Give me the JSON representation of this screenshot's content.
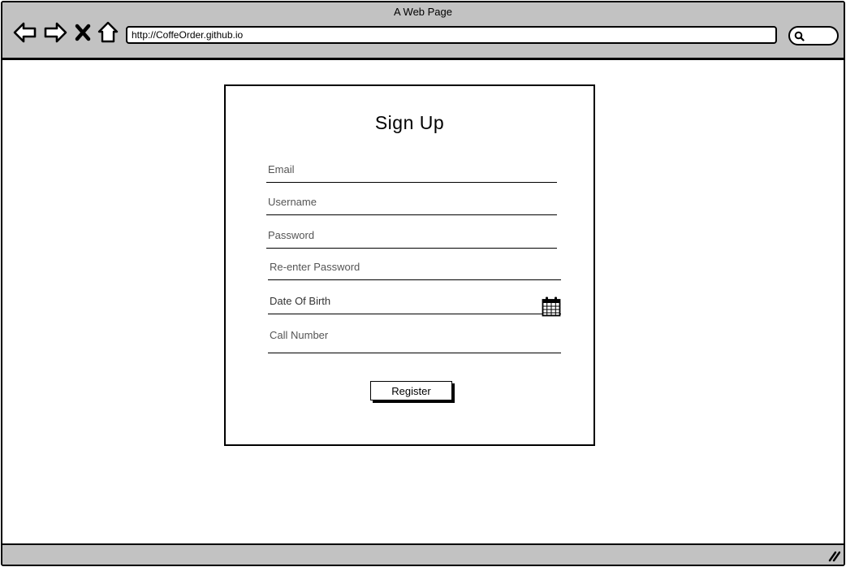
{
  "window": {
    "title": "A Web Page"
  },
  "browser": {
    "url": "http://CoffeOrder.github.io",
    "icons": [
      "back-arrow-icon",
      "forward-arrow-icon",
      "close-icon",
      "home-icon",
      "search-icon"
    ]
  },
  "form": {
    "title": "Sign Up",
    "fields": [
      {
        "placeholder": "Email"
      },
      {
        "placeholder": "Username"
      },
      {
        "placeholder": "Password"
      },
      {
        "placeholder": "Re-enter Password"
      },
      {
        "placeholder": "Date Of Birth",
        "icon": "calendar-icon"
      },
      {
        "placeholder": "Call Number"
      }
    ],
    "submit_label": "Register"
  },
  "colors": {
    "chrome": "#c2c2c2",
    "border": "#000000",
    "background": "#ffffff"
  }
}
